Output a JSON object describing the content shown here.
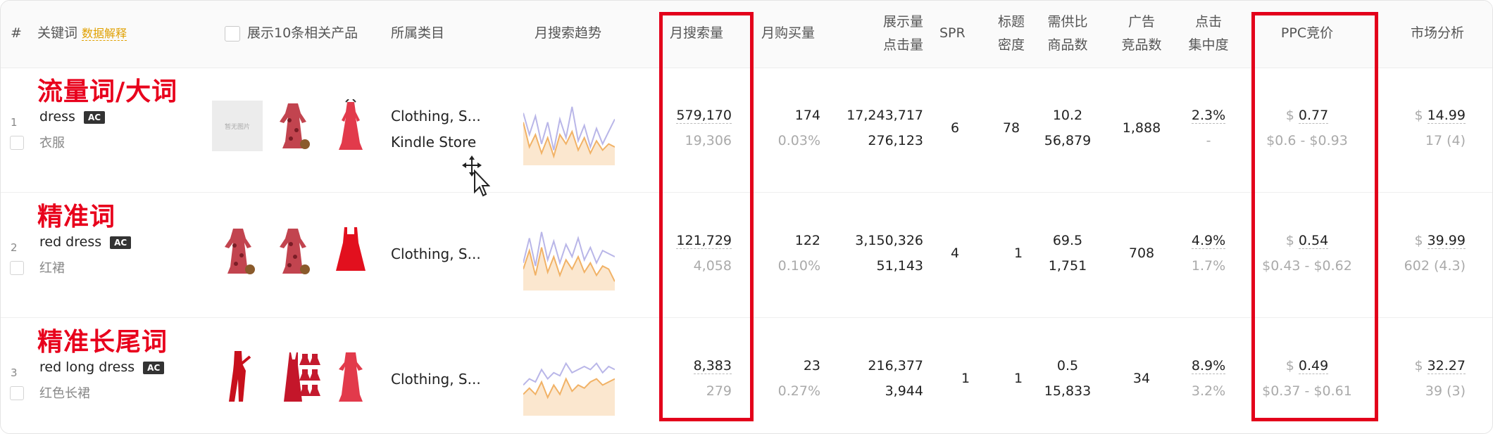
{
  "header": {
    "index": "#",
    "keyword": "关键词",
    "data_explain": "数据解释",
    "show_products": "展示10条相关产品",
    "category": "所属类目",
    "trend": "月搜索趋势",
    "monthly_search": "月搜索量",
    "monthly_purchase": "月购买量",
    "impressions_line1": "展示量",
    "impressions_line2": "点击量",
    "spr": "SPR",
    "title_density_line1": "标题",
    "title_density_line2": "密度",
    "supply_demand_line1": "需供比",
    "supply_demand_line2": "商品数",
    "ads_line1": "广告",
    "ads_line2": "竞品数",
    "click_conc_line1": "点击",
    "click_conc_line2": "集中度",
    "ppc": "PPC竞价",
    "market": "市场分析"
  },
  "rows": [
    {
      "tag": "流量词/大词",
      "index": "1",
      "keyword": "dress",
      "badge": "AC",
      "keyword_cn": "衣服",
      "categories": [
        "Clothing, S...",
        "Kindle Store"
      ],
      "placeholder_text": "暂无图片",
      "monthly_search": "579,170",
      "monthly_search_sub": "19,306",
      "monthly_purchase": "174",
      "monthly_purchase_sub": "0.03%",
      "impressions": "17,243,717",
      "clicks": "276,123",
      "spr": "6",
      "title_density": "78",
      "supply_demand": "10.2",
      "products": "56,879",
      "ads": "1,888",
      "click_conc": "2.3%",
      "click_conc_sub": "-",
      "ppc": "0.77",
      "ppc_range": "$0.6 - $0.93",
      "market_price": "14.99",
      "market_sub": "17 (4)",
      "trend_purple": [
        0.2,
        0.55,
        0.25,
        0.7,
        0.35,
        0.8,
        0.3,
        0.6,
        0.1,
        0.65,
        0.4,
        0.75,
        0.45,
        0.7,
        0.5,
        0.3
      ],
      "trend_orange": [
        0.35,
        0.75,
        0.55,
        0.85,
        0.6,
        0.9,
        0.55,
        0.7,
        0.5,
        0.8,
        0.6,
        0.85,
        0.65,
        0.8,
        0.7,
        0.75
      ]
    },
    {
      "tag": "精准词",
      "index": "2",
      "keyword": "red dress",
      "badge": "AC",
      "keyword_cn": "红裙",
      "categories": [
        "Clothing, S..."
      ],
      "monthly_search": "121,729",
      "monthly_search_sub": "4,058",
      "monthly_purchase": "122",
      "monthly_purchase_sub": "0.10%",
      "impressions": "3,150,326",
      "clicks": "51,143",
      "spr": "4",
      "title_density": "1",
      "supply_demand": "69.5",
      "products": "1,751",
      "ads": "708",
      "click_conc": "4.9%",
      "click_conc_sub": "1.7%",
      "ppc": "0.54",
      "ppc_range": "$0.43 - $0.62",
      "market_price": "39.99",
      "market_sub": "602 (4.3)",
      "trend_purple": [
        0.6,
        0.2,
        0.65,
        0.1,
        0.55,
        0.25,
        0.6,
        0.3,
        0.5,
        0.2,
        0.55,
        0.35,
        0.6,
        0.4,
        0.45,
        0.5
      ],
      "trend_orange": [
        0.7,
        0.4,
        0.8,
        0.35,
        0.75,
        0.5,
        0.8,
        0.55,
        0.7,
        0.5,
        0.75,
        0.6,
        0.8,
        0.65,
        0.7,
        0.9
      ]
    },
    {
      "tag": "精准长尾词",
      "index": "3",
      "keyword": "red long dress",
      "badge": "AC",
      "keyword_cn": "红色长裙",
      "categories": [
        "Clothing, S..."
      ],
      "monthly_search": "8,383",
      "monthly_search_sub": "279",
      "monthly_purchase": "23",
      "monthly_purchase_sub": "0.27%",
      "impressions": "216,377",
      "clicks": "3,944",
      "spr": "1",
      "title_density": "1",
      "supply_demand": "0.5",
      "products": "15,833",
      "ads": "34",
      "click_conc": "8.9%",
      "click_conc_sub": "3.2%",
      "ppc": "0.49",
      "ppc_range": "$0.37 - $0.61",
      "market_price": "32.27",
      "market_sub": "39 (3)",
      "trend_purple": [
        0.55,
        0.45,
        0.5,
        0.3,
        0.45,
        0.35,
        0.4,
        0.2,
        0.35,
        0.3,
        0.25,
        0.3,
        0.2,
        0.35,
        0.25,
        0.3
      ],
      "trend_orange": [
        0.7,
        0.6,
        0.7,
        0.5,
        0.75,
        0.55,
        0.7,
        0.45,
        0.65,
        0.55,
        0.6,
        0.5,
        0.45,
        0.55,
        0.5,
        0.45
      ]
    }
  ],
  "colors": {
    "highlight_box": "#e3001b",
    "tag_text": "#e8001c",
    "trend_purple": "#b9b6e8",
    "trend_orange": "#f1b266",
    "trend_fill": "#fbe7cf",
    "dress_red": "#e23a4b",
    "dress_floral": "#c2444f"
  }
}
